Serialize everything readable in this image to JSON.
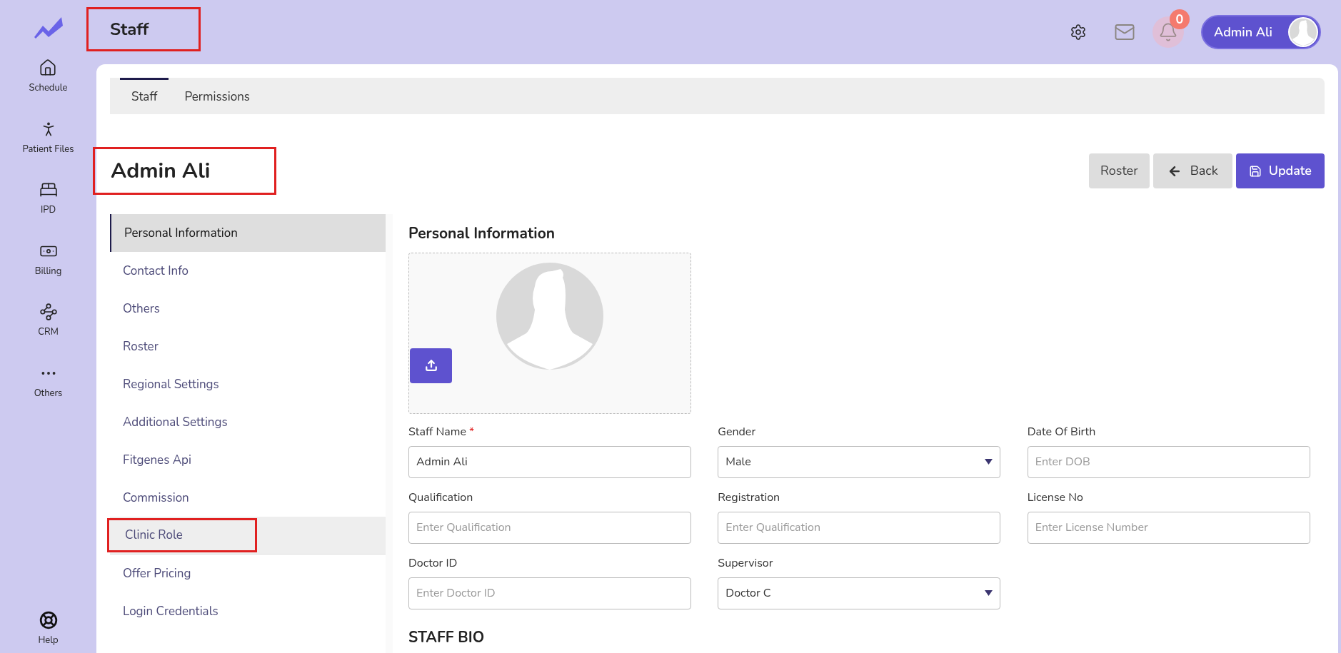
{
  "page_title": {
    "text": "Staff",
    "highlighted": true
  },
  "sidebar": {
    "items": [
      {
        "label": "Schedule"
      },
      {
        "label": "Patient Files"
      },
      {
        "label": "IPD"
      },
      {
        "label": "Billing"
      },
      {
        "label": "CRM"
      },
      {
        "label": "Others"
      }
    ],
    "help": {
      "label": "Help"
    }
  },
  "header": {
    "notification_count": "0",
    "user_name": "Admin Ali"
  },
  "tabs": [
    {
      "label": "Staff",
      "selected": true
    },
    {
      "label": "Permissions",
      "selected": false
    }
  ],
  "heading": {
    "text": "Admin Ali",
    "highlighted": true
  },
  "actions": [
    {
      "label": "Roster",
      "kind": "plain"
    },
    {
      "label": "Back",
      "kind": "back"
    },
    {
      "label": "Update",
      "kind": "primary"
    }
  ],
  "menu": [
    {
      "label": "Personal Information",
      "selected": true,
      "highlighted": false
    },
    {
      "label": "Contact Info",
      "selected": false,
      "highlighted": false
    },
    {
      "label": "Others",
      "selected": false,
      "highlighted": false
    },
    {
      "label": "Roster",
      "selected": false,
      "highlighted": false
    },
    {
      "label": "Regional Settings",
      "selected": false,
      "highlighted": false
    },
    {
      "label": "Additional Settings",
      "selected": false,
      "highlighted": false
    },
    {
      "label": "Fitgenes Api",
      "selected": false,
      "highlighted": false
    },
    {
      "label": "Commission",
      "selected": false,
      "highlighted": false
    },
    {
      "label": "Clinic Role",
      "selected": false,
      "highlighted": true
    },
    {
      "label": "Offer Pricing",
      "selected": false,
      "highlighted": false
    },
    {
      "label": "Login Credentials",
      "selected": false,
      "highlighted": false
    }
  ],
  "section_title": "Personal Information",
  "fields": [
    {
      "label": "Staff Name",
      "required_mark": "*",
      "kind": "text",
      "value": "Admin Ali"
    },
    {
      "label": "Gender",
      "kind": "select",
      "value": "Male"
    },
    {
      "label": "Date Of Birth",
      "kind": "text",
      "placeholder": "Enter DOB"
    },
    {
      "label": "Qualification",
      "kind": "text",
      "placeholder": "Enter Qualification"
    },
    {
      "label": "Registration",
      "kind": "text",
      "placeholder": "Enter Qualification"
    },
    {
      "label": "License No",
      "kind": "text",
      "placeholder": "Enter License Number"
    },
    {
      "label": "Doctor ID",
      "kind": "text",
      "placeholder": "Enter Doctor ID"
    },
    {
      "label": "Supervisor",
      "kind": "select",
      "value": "Doctor C"
    }
  ],
  "bio_title": "STAFF BIO"
}
